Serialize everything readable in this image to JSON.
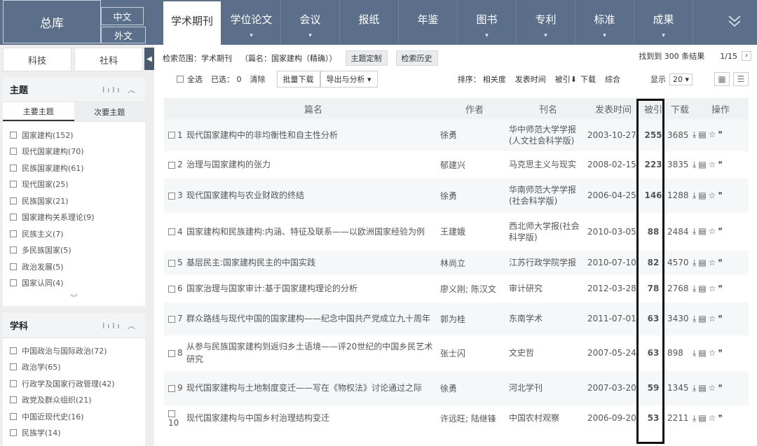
{
  "top": {
    "zongku": "总库",
    "lang_zh": "中文",
    "lang_wai": "外文",
    "tabs": [
      {
        "label": "学术期刊",
        "caret": ""
      },
      {
        "label": "学位论文",
        "caret": "▾"
      },
      {
        "label": "会议",
        "caret": "▾"
      },
      {
        "label": "报纸",
        "caret": ""
      },
      {
        "label": "年鉴",
        "caret": ""
      },
      {
        "label": "图书",
        "caret": "▾"
      },
      {
        "label": "专利",
        "caret": "▾"
      },
      {
        "label": "标准",
        "caret": "▾"
      },
      {
        "label": "成果",
        "caret": "▾"
      }
    ],
    "menu_icon": "double-chevron-down-icon"
  },
  "sidebar": {
    "switch": {
      "keji": "科技",
      "sheke": "社科"
    },
    "topic": {
      "title": "主题",
      "subtabs": [
        "主要主题",
        "次要主题"
      ],
      "items": [
        "国家建构(152)",
        "现代国家建构(70)",
        "民族国家建构(61)",
        "现代国家(25)",
        "民族国家(21)",
        "国家建构关系理论(9)",
        "民族主义(7)",
        "多民族国家(5)",
        "政治发展(5)",
        "国家认同(4)"
      ]
    },
    "discipline": {
      "title": "学科",
      "items": [
        "中国政治与国际政治(72)",
        "政治学(65)",
        "行政学及国家行政管理(42)",
        "政党及群众组织(21)",
        "中国近现代史(16)",
        "民族学(14)"
      ]
    }
  },
  "scope": {
    "label": "检索范围：学术期刊",
    "query": "（篇名：国家建构（精确））",
    "topic_btn": "主题定制",
    "history_btn": "检索历史"
  },
  "result_info": {
    "found": "找到到 300 条结果",
    "page": "1/15"
  },
  "toolbar": {
    "select_all": "全选",
    "selected": "已选： 0",
    "clear": "清除",
    "batch_download": "批量下载",
    "export": "导出与分析 ▾",
    "sort_label": "排序：",
    "sort_options": [
      "相关度",
      "发表时间",
      "被引⬇",
      "下载",
      "综合"
    ],
    "display_label": "显示",
    "display_value": "20 ▾"
  },
  "table": {
    "headers": [
      "篇名",
      "作者",
      "刊名",
      "发表时间",
      "被引",
      "下载",
      "操作"
    ],
    "rows": [
      {
        "num": "1",
        "title": "现代国家建构中的非均衡性和自主性分析",
        "author": "徐勇",
        "journal": "华中师范大学学报(人文社会科学版)",
        "date": "2003-10-27",
        "cite": "255",
        "dl": "3685"
      },
      {
        "num": "2",
        "title": "治理与国家建构的张力",
        "author": "郁建兴",
        "journal": "马克思主义与现实",
        "date": "2008-02-15",
        "cite": "223",
        "dl": "3835"
      },
      {
        "num": "3",
        "title": "现代国家建构与农业财政的终结",
        "author": "徐勇",
        "journal": "华南师范大学学报(社会科学版)",
        "date": "2006-04-25",
        "cite": "146",
        "dl": "1288"
      },
      {
        "num": "4",
        "title": "国家建构和民族建构:内涵、特征及联系——以欧洲国家经验为例",
        "author": "王建娥",
        "journal": "西北师大学报(社会科学版)",
        "date": "2010-03-05",
        "cite": "88",
        "dl": "2484"
      },
      {
        "num": "5",
        "title": "基层民主:国家建构民主的中国实践",
        "author": "林尚立",
        "journal": "江苏行政学院学报",
        "date": "2010-07-10",
        "cite": "82",
        "dl": "4570"
      },
      {
        "num": "6",
        "title": "国家治理与国家审计:基于国家建构理论的分析",
        "author": "廖义刚; 陈汉文",
        "journal": "审计研究",
        "date": "2012-03-28",
        "cite": "78",
        "dl": "2768"
      },
      {
        "num": "7",
        "title": "群众路线与现代中国的国家建构——纪念中国共产党成立九十周年",
        "author": "郭为桂",
        "journal": "东南学术",
        "date": "2011-07-01",
        "cite": "63",
        "dl": "3430"
      },
      {
        "num": "8",
        "title": "从参与民族国家建构到返归乡土语境——评20世纪的中国乡民艺术研究",
        "author": "张士闪",
        "journal": "文史哲",
        "date": "2007-05-24",
        "cite": "63",
        "dl": "898"
      },
      {
        "num": "9",
        "title": "现代国家建构与土地制度变迁——写在《物权法》讨论通过之际",
        "author": "徐勇",
        "journal": "河北学刊",
        "date": "2007-03-20",
        "cite": "59",
        "dl": "1345"
      },
      {
        "num": "10",
        "title": "现代国家建构与中国乡村治理结构变迁",
        "author": "许远旺; 陆继锋",
        "journal": "中国农村观察",
        "date": "2006-09-20",
        "cite": "53",
        "dl": "2211"
      }
    ],
    "op_icons": [
      "download-icon",
      "read-icon",
      "favorite-star-icon",
      "cite-quote-icon"
    ]
  }
}
